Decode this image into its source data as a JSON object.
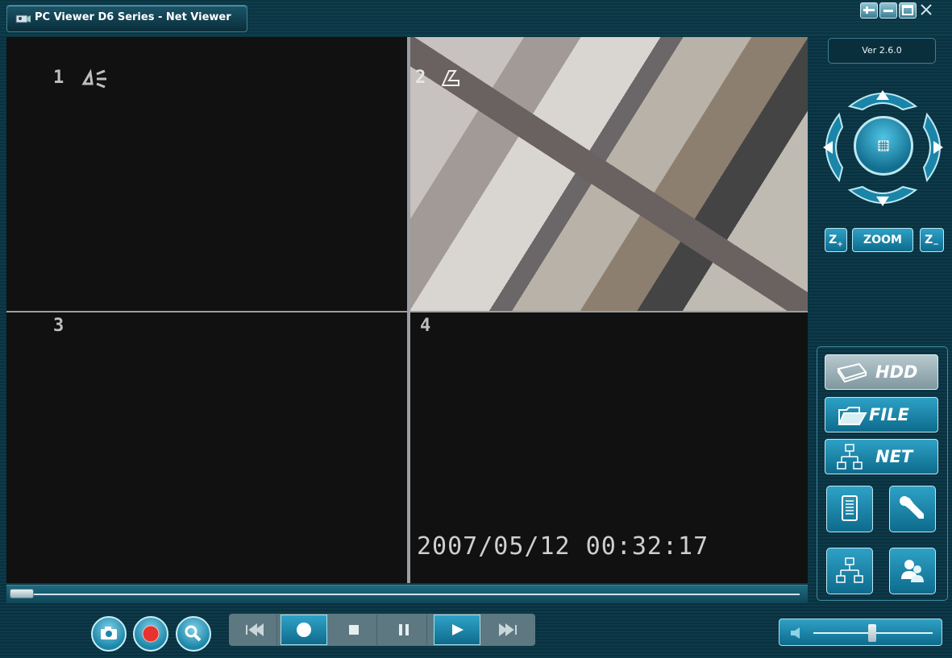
{
  "window": {
    "title": "PC Viewer D6 Series - Net Viewer",
    "controls": [
      "pin-icon",
      "minimize-icon",
      "maximize-icon",
      "close-icon"
    ]
  },
  "version": "Ver 2.6.0",
  "channels": [
    {
      "number": "1",
      "audio_icon": "audio-icon"
    },
    {
      "number": "2",
      "audio_icon": "audio-icon"
    },
    {
      "number": "3"
    },
    {
      "number": "4"
    }
  ],
  "timestamp": "2007/05/12 00:32:17",
  "ptz": {
    "up": "up-arrow-icon",
    "down": "down-arrow-icon",
    "left": "left-arrow-icon",
    "right": "right-arrow-icon",
    "center": "grid-icon",
    "zoom_in": "Z",
    "zoom_label": "ZOOM",
    "zoom_out": "Z"
  },
  "modes": [
    {
      "label": "HDD",
      "icon": "hdd-icon",
      "selected": true
    },
    {
      "label": "FILE",
      "icon": "folder-icon",
      "selected": false
    },
    {
      "label": "NET",
      "icon": "network-icon",
      "selected": false
    }
  ],
  "tools": [
    "log-icon",
    "wrench-icon",
    "network-icon",
    "users-icon"
  ],
  "bottom_buttons": [
    "camera-icon",
    "record-icon",
    "search-icon"
  ],
  "transport": [
    "skip-back-icon",
    "record-dot-icon",
    "stop-icon",
    "pause-icon",
    "play-icon",
    "skip-forward-icon"
  ],
  "colors": {
    "accent": "#1f93b8",
    "background": "#0d3a49"
  }
}
